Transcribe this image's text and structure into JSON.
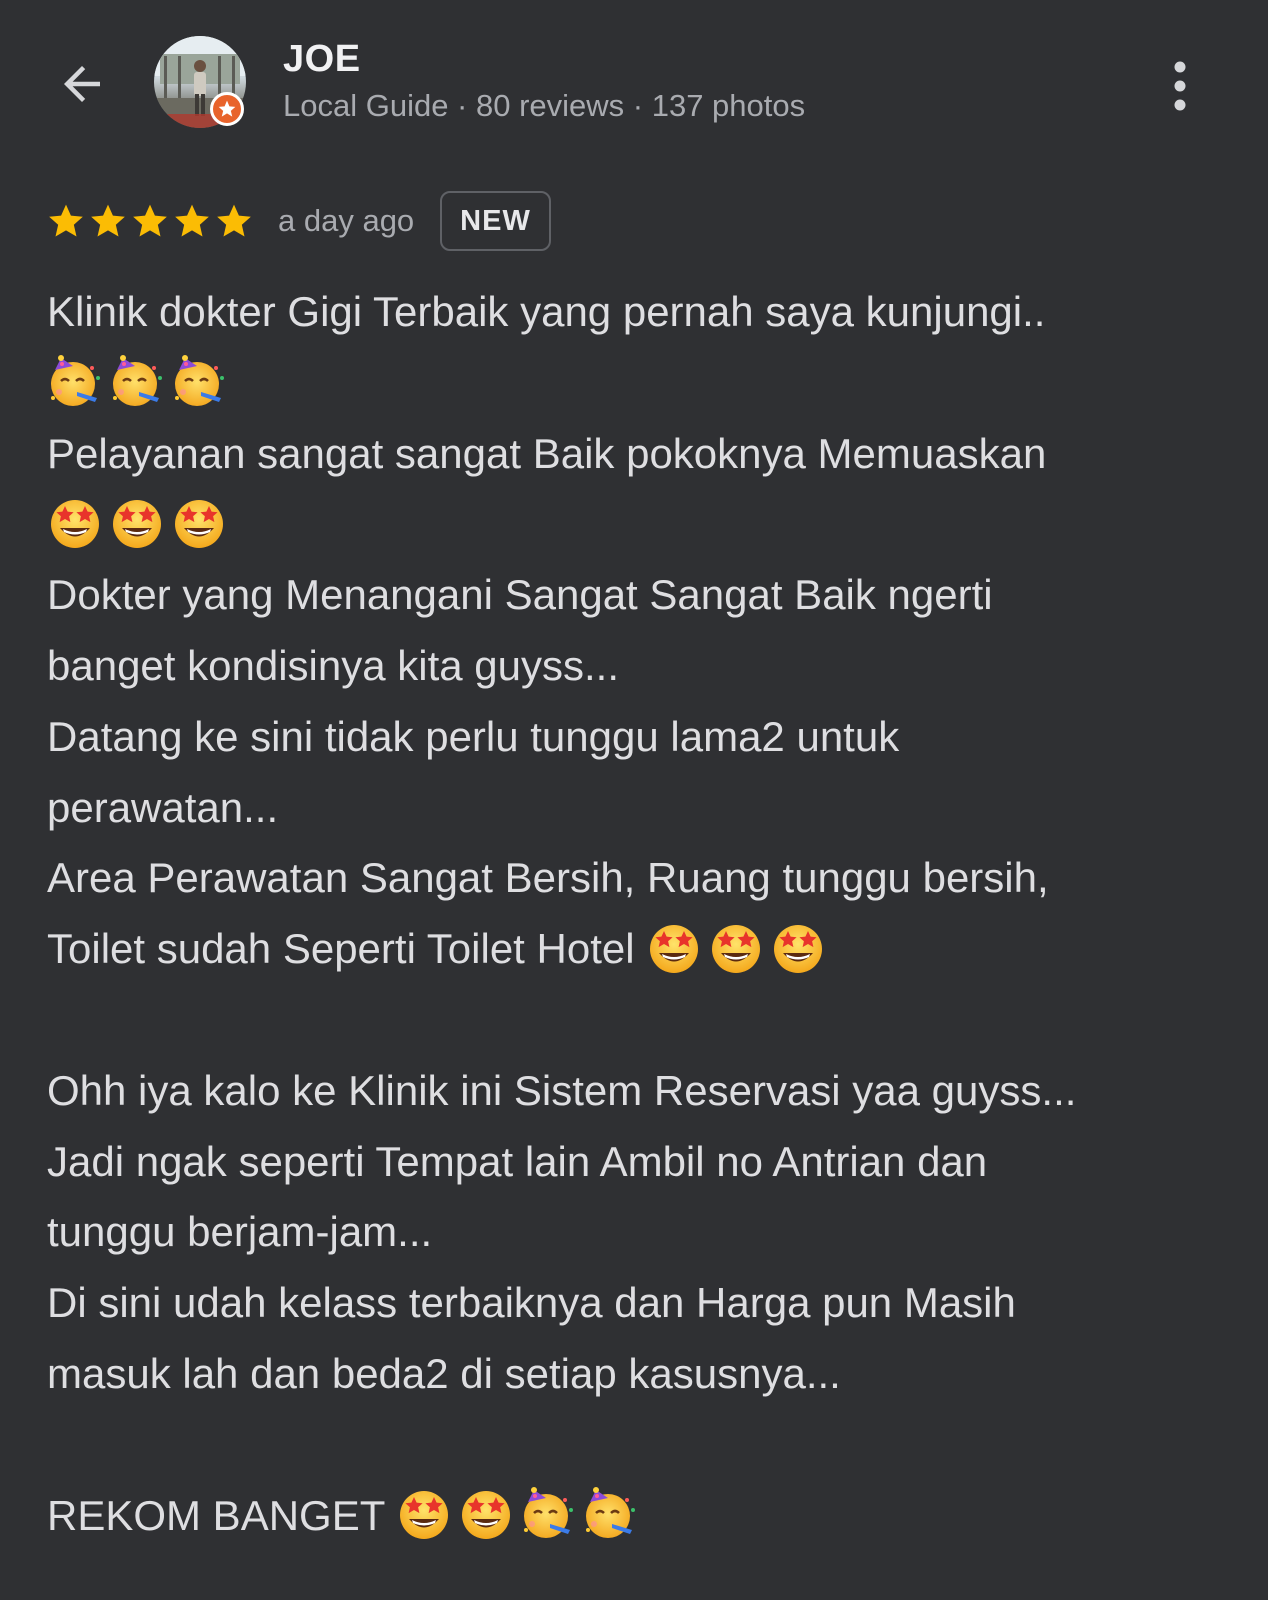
{
  "header": {
    "back_icon": "arrow-left-icon",
    "name": "JOE",
    "subtitle": "Local Guide · 80 reviews · 137 photos",
    "more_icon": "more-vert-icon",
    "badge_icon": "local-guide-star-icon"
  },
  "rating": {
    "stars": 5,
    "time": "a day ago",
    "badge": "NEW"
  },
  "review": {
    "lines": [
      {
        "text": "Klinik dokter Gigi Terbaik yang pernah saya kunjungi..",
        "emojis": []
      },
      {
        "text": "",
        "emojis": [
          "party-face",
          "party-face",
          "party-face"
        ]
      },
      {
        "text": "Pelayanan sangat sangat Baik pokoknya Memuaskan",
        "emojis": []
      },
      {
        "text": "",
        "emojis": [
          "star-struck",
          "star-struck",
          "star-struck"
        ]
      },
      {
        "text": "Dokter yang Menangani Sangat Sangat Baik ngerti",
        "emojis": []
      },
      {
        "text": "banget kondisinya kita guyss...",
        "emojis": []
      },
      {
        "text": "Datang ke sini tidak perlu tunggu lama2 untuk",
        "emojis": []
      },
      {
        "text": "perawatan...",
        "emojis": []
      },
      {
        "text": "Area Perawatan Sangat Bersih, Ruang tunggu bersih,",
        "emojis": []
      },
      {
        "text": "Toilet sudah Seperti Toilet Hotel ",
        "emojis": [
          "star-struck",
          "star-struck",
          "star-struck"
        ]
      },
      {
        "text": "",
        "emojis": []
      },
      {
        "text": "Ohh iya kalo ke Klinik ini Sistem Reservasi yaa guyss...",
        "emojis": []
      },
      {
        "text": "Jadi ngak seperti Tempat lain Ambil no Antrian dan",
        "emojis": []
      },
      {
        "text": "tunggu berjam-jam...",
        "emojis": []
      },
      {
        "text": "Di sini udah kelass terbaiknya dan Harga pun Masih",
        "emojis": []
      },
      {
        "text": "masuk lah dan beda2 di setiap kasusnya...",
        "emojis": []
      },
      {
        "text": "",
        "emojis": []
      },
      {
        "text": "REKOM BANGET ",
        "emojis": [
          "star-struck",
          "star-struck",
          "party-face",
          "party-face"
        ]
      }
    ]
  },
  "colors": {
    "background": "#2f3033",
    "star": "#fbbc04",
    "badge": "#e8632b"
  }
}
